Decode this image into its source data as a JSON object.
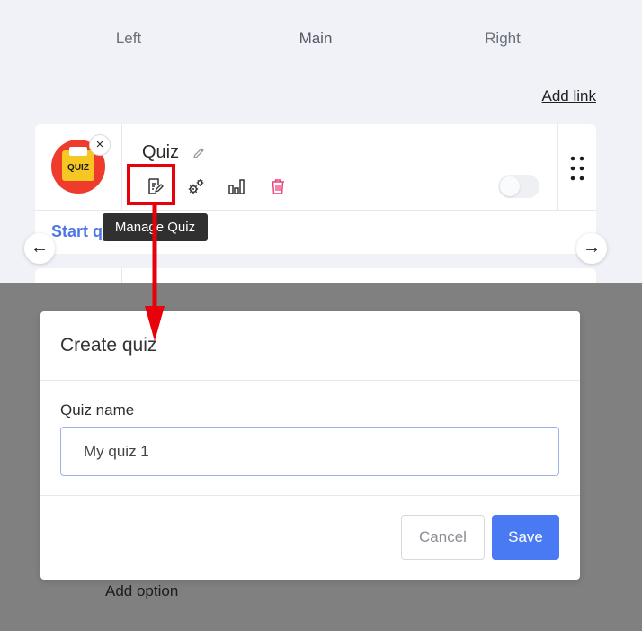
{
  "tabs": [
    {
      "label": "Left",
      "active": false
    },
    {
      "label": "Main",
      "active": true
    },
    {
      "label": "Right",
      "active": false
    }
  ],
  "add_link": "Add link",
  "card": {
    "logo_text": "QUIZ",
    "title": "Quiz",
    "close_glyph": "×",
    "start_text": "Start q",
    "toggle_on": false,
    "tools": [
      "manage-quiz-icon",
      "settings-gears-icon",
      "bar-chart-icon",
      "trash-icon"
    ]
  },
  "tooltip": "Manage Quiz",
  "nav": {
    "prev": "←",
    "next": "→"
  },
  "modal": {
    "title": "Create quiz",
    "field_label": "Quiz name",
    "input_value": "My quiz 1",
    "cancel_label": "Cancel",
    "save_label": "Save"
  },
  "add_option": "Add option",
  "colors": {
    "accent": "#4a7af3",
    "highlight": "#e8000b",
    "overlay": "#808080",
    "delete": "#e8447a"
  }
}
